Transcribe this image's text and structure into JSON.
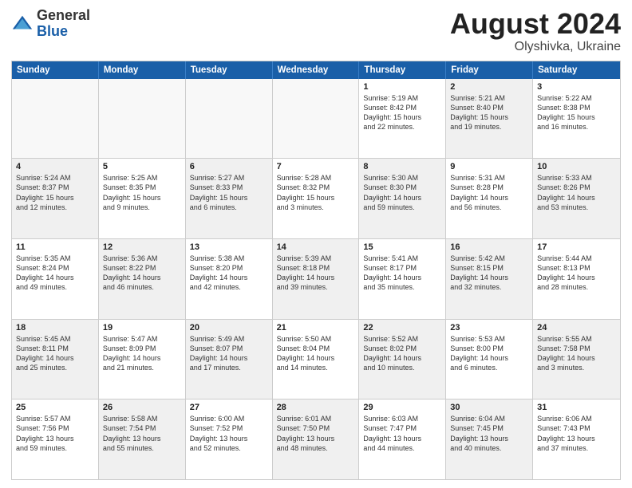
{
  "logo": {
    "general": "General",
    "blue": "Blue"
  },
  "title": {
    "month": "August 2024",
    "location": "Olyshivka, Ukraine"
  },
  "header_days": [
    "Sunday",
    "Monday",
    "Tuesday",
    "Wednesday",
    "Thursday",
    "Friday",
    "Saturday"
  ],
  "weeks": [
    [
      {
        "day": "",
        "text": "",
        "shaded": false,
        "empty": true
      },
      {
        "day": "",
        "text": "",
        "shaded": false,
        "empty": true
      },
      {
        "day": "",
        "text": "",
        "shaded": false,
        "empty": true
      },
      {
        "day": "",
        "text": "",
        "shaded": false,
        "empty": true
      },
      {
        "day": "1",
        "text": "Sunrise: 5:19 AM\nSunset: 8:42 PM\nDaylight: 15 hours\nand 22 minutes.",
        "shaded": false,
        "empty": false
      },
      {
        "day": "2",
        "text": "Sunrise: 5:21 AM\nSunset: 8:40 PM\nDaylight: 15 hours\nand 19 minutes.",
        "shaded": true,
        "empty": false
      },
      {
        "day": "3",
        "text": "Sunrise: 5:22 AM\nSunset: 8:38 PM\nDaylight: 15 hours\nand 16 minutes.",
        "shaded": false,
        "empty": false
      }
    ],
    [
      {
        "day": "4",
        "text": "Sunrise: 5:24 AM\nSunset: 8:37 PM\nDaylight: 15 hours\nand 12 minutes.",
        "shaded": true,
        "empty": false
      },
      {
        "day": "5",
        "text": "Sunrise: 5:25 AM\nSunset: 8:35 PM\nDaylight: 15 hours\nand 9 minutes.",
        "shaded": false,
        "empty": false
      },
      {
        "day": "6",
        "text": "Sunrise: 5:27 AM\nSunset: 8:33 PM\nDaylight: 15 hours\nand 6 minutes.",
        "shaded": true,
        "empty": false
      },
      {
        "day": "7",
        "text": "Sunrise: 5:28 AM\nSunset: 8:32 PM\nDaylight: 15 hours\nand 3 minutes.",
        "shaded": false,
        "empty": false
      },
      {
        "day": "8",
        "text": "Sunrise: 5:30 AM\nSunset: 8:30 PM\nDaylight: 14 hours\nand 59 minutes.",
        "shaded": true,
        "empty": false
      },
      {
        "day": "9",
        "text": "Sunrise: 5:31 AM\nSunset: 8:28 PM\nDaylight: 14 hours\nand 56 minutes.",
        "shaded": false,
        "empty": false
      },
      {
        "day": "10",
        "text": "Sunrise: 5:33 AM\nSunset: 8:26 PM\nDaylight: 14 hours\nand 53 minutes.",
        "shaded": true,
        "empty": false
      }
    ],
    [
      {
        "day": "11",
        "text": "Sunrise: 5:35 AM\nSunset: 8:24 PM\nDaylight: 14 hours\nand 49 minutes.",
        "shaded": false,
        "empty": false
      },
      {
        "day": "12",
        "text": "Sunrise: 5:36 AM\nSunset: 8:22 PM\nDaylight: 14 hours\nand 46 minutes.",
        "shaded": true,
        "empty": false
      },
      {
        "day": "13",
        "text": "Sunrise: 5:38 AM\nSunset: 8:20 PM\nDaylight: 14 hours\nand 42 minutes.",
        "shaded": false,
        "empty": false
      },
      {
        "day": "14",
        "text": "Sunrise: 5:39 AM\nSunset: 8:18 PM\nDaylight: 14 hours\nand 39 minutes.",
        "shaded": true,
        "empty": false
      },
      {
        "day": "15",
        "text": "Sunrise: 5:41 AM\nSunset: 8:17 PM\nDaylight: 14 hours\nand 35 minutes.",
        "shaded": false,
        "empty": false
      },
      {
        "day": "16",
        "text": "Sunrise: 5:42 AM\nSunset: 8:15 PM\nDaylight: 14 hours\nand 32 minutes.",
        "shaded": true,
        "empty": false
      },
      {
        "day": "17",
        "text": "Sunrise: 5:44 AM\nSunset: 8:13 PM\nDaylight: 14 hours\nand 28 minutes.",
        "shaded": false,
        "empty": false
      }
    ],
    [
      {
        "day": "18",
        "text": "Sunrise: 5:45 AM\nSunset: 8:11 PM\nDaylight: 14 hours\nand 25 minutes.",
        "shaded": true,
        "empty": false
      },
      {
        "day": "19",
        "text": "Sunrise: 5:47 AM\nSunset: 8:09 PM\nDaylight: 14 hours\nand 21 minutes.",
        "shaded": false,
        "empty": false
      },
      {
        "day": "20",
        "text": "Sunrise: 5:49 AM\nSunset: 8:07 PM\nDaylight: 14 hours\nand 17 minutes.",
        "shaded": true,
        "empty": false
      },
      {
        "day": "21",
        "text": "Sunrise: 5:50 AM\nSunset: 8:04 PM\nDaylight: 14 hours\nand 14 minutes.",
        "shaded": false,
        "empty": false
      },
      {
        "day": "22",
        "text": "Sunrise: 5:52 AM\nSunset: 8:02 PM\nDaylight: 14 hours\nand 10 minutes.",
        "shaded": true,
        "empty": false
      },
      {
        "day": "23",
        "text": "Sunrise: 5:53 AM\nSunset: 8:00 PM\nDaylight: 14 hours\nand 6 minutes.",
        "shaded": false,
        "empty": false
      },
      {
        "day": "24",
        "text": "Sunrise: 5:55 AM\nSunset: 7:58 PM\nDaylight: 14 hours\nand 3 minutes.",
        "shaded": true,
        "empty": false
      }
    ],
    [
      {
        "day": "25",
        "text": "Sunrise: 5:57 AM\nSunset: 7:56 PM\nDaylight: 13 hours\nand 59 minutes.",
        "shaded": false,
        "empty": false
      },
      {
        "day": "26",
        "text": "Sunrise: 5:58 AM\nSunset: 7:54 PM\nDaylight: 13 hours\nand 55 minutes.",
        "shaded": true,
        "empty": false
      },
      {
        "day": "27",
        "text": "Sunrise: 6:00 AM\nSunset: 7:52 PM\nDaylight: 13 hours\nand 52 minutes.",
        "shaded": false,
        "empty": false
      },
      {
        "day": "28",
        "text": "Sunrise: 6:01 AM\nSunset: 7:50 PM\nDaylight: 13 hours\nand 48 minutes.",
        "shaded": true,
        "empty": false
      },
      {
        "day": "29",
        "text": "Sunrise: 6:03 AM\nSunset: 7:47 PM\nDaylight: 13 hours\nand 44 minutes.",
        "shaded": false,
        "empty": false
      },
      {
        "day": "30",
        "text": "Sunrise: 6:04 AM\nSunset: 7:45 PM\nDaylight: 13 hours\nand 40 minutes.",
        "shaded": true,
        "empty": false
      },
      {
        "day": "31",
        "text": "Sunrise: 6:06 AM\nSunset: 7:43 PM\nDaylight: 13 hours\nand 37 minutes.",
        "shaded": false,
        "empty": false
      }
    ]
  ]
}
